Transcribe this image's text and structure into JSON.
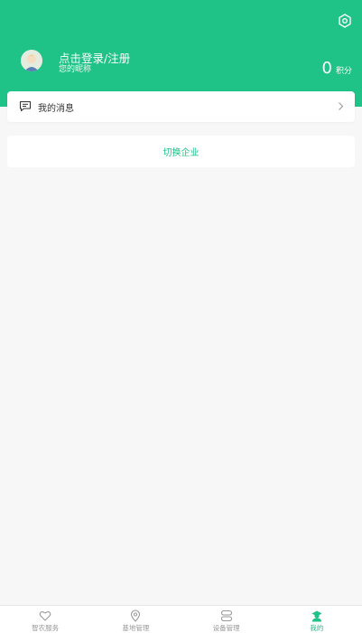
{
  "colors": {
    "accent": "#1fc287",
    "background": "#f7f7f7",
    "tab_inactive": "#999999"
  },
  "header": {
    "login_title": "点击登录/注册",
    "nickname": "您的昵称",
    "points_value": "0",
    "points_label": "积分",
    "settings_icon": "gear-icon",
    "avatar_icon": "avatar"
  },
  "menu": {
    "messages_label": "我的消息",
    "messages_icon": "message-icon",
    "chevron_icon": "chevron-right-icon"
  },
  "switch_enterprise_label": "切换企业",
  "tabbar": {
    "tabs": [
      {
        "label": "智农服务",
        "icon": "heart-icon",
        "active": false
      },
      {
        "label": "基地管理",
        "icon": "location-pin-icon",
        "active": false
      },
      {
        "label": "设备管理",
        "icon": "device-icon",
        "active": false
      },
      {
        "label": "我的",
        "icon": "user-icon",
        "active": true
      }
    ]
  }
}
